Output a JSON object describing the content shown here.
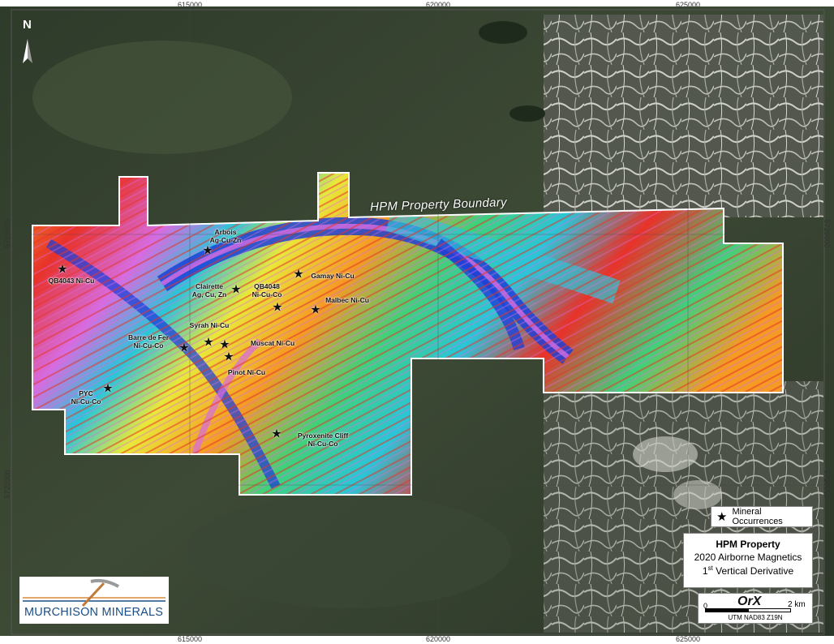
{
  "map": {
    "property_label": "HPM Property Boundary",
    "north_label": "N",
    "eastings_top": [
      "615000",
      "620000",
      "625000"
    ],
    "eastings_bottom": [
      "615000",
      "620000",
      "625000"
    ],
    "northings_left": [
      "5725000",
      "5720000"
    ],
    "northings_right": [
      "5725000",
      "5720000"
    ],
    "occurrences": [
      {
        "name": "Arbois\nAg-Cu-Zn",
        "label_lines": [
          "Arbois",
          "Ag-Cu-Zn"
        ]
      },
      {
        "name": "QB4043 Ni-Cu",
        "label_lines": [
          "QB4043 Ni-Cu"
        ]
      },
      {
        "name": "Gamay Ni-Cu",
        "label_lines": [
          "Gamay Ni-Cu"
        ]
      },
      {
        "name": "Clairette",
        "label_lines": [
          "Clairette",
          "Ag, Cu, Zn"
        ]
      },
      {
        "name": "QB4048",
        "label_lines": [
          "QB4048",
          "Ni-Cu-Co"
        ]
      },
      {
        "name": "Malbec Ni-Cu",
        "label_lines": [
          "Malbec Ni-Cu"
        ]
      },
      {
        "name": "Syrah Ni-Cu",
        "label_lines": [
          "Syrah Ni-Cu"
        ]
      },
      {
        "name": "Barre de Fer",
        "label_lines": [
          "Barre de Fer",
          "Ni-Cu-Co"
        ]
      },
      {
        "name": "Muscat Ni-Cu",
        "label_lines": [
          "Muscat Ni-Cu"
        ]
      },
      {
        "name": "Pinot Ni-Cu",
        "label_lines": [
          "Pinot Ni-Cu"
        ]
      },
      {
        "name": "PYC",
        "label_lines": [
          "PYC",
          "Ni-Cu-Co"
        ]
      },
      {
        "name": "Pyroxenite Cliff",
        "label_lines": [
          "Pyroxenite Cliff",
          "Ni-Cu-Co"
        ]
      }
    ]
  },
  "legend": {
    "symbol_label": "Mineral Occurrences"
  },
  "title_block": {
    "line1": "HPM Property",
    "line2": "2020 Airborne Magnetics",
    "line3_prefix": "1",
    "line3_sup": "st",
    "line3_suffix": " Vertical Derivative"
  },
  "scale": {
    "zero": "0",
    "end": "2 km",
    "logo": "OrX",
    "projection": "UTM NAD83 Z19N"
  },
  "logo": {
    "company": "MURCHISON MINERALS"
  },
  "colors": {
    "satellite_dark": "#34412e",
    "satellite_light": "#cfd2c8",
    "mag_red": "#e8322a",
    "mag_orange": "#f59a23",
    "mag_yellow": "#e9e83a",
    "mag_green": "#3fd17a",
    "mag_cyan": "#29c6d8",
    "mag_blue": "#1f3fd8",
    "mag_magenta": "#d76be0",
    "boundary": "#ffffff",
    "logo_blue": "#1a4f86"
  }
}
